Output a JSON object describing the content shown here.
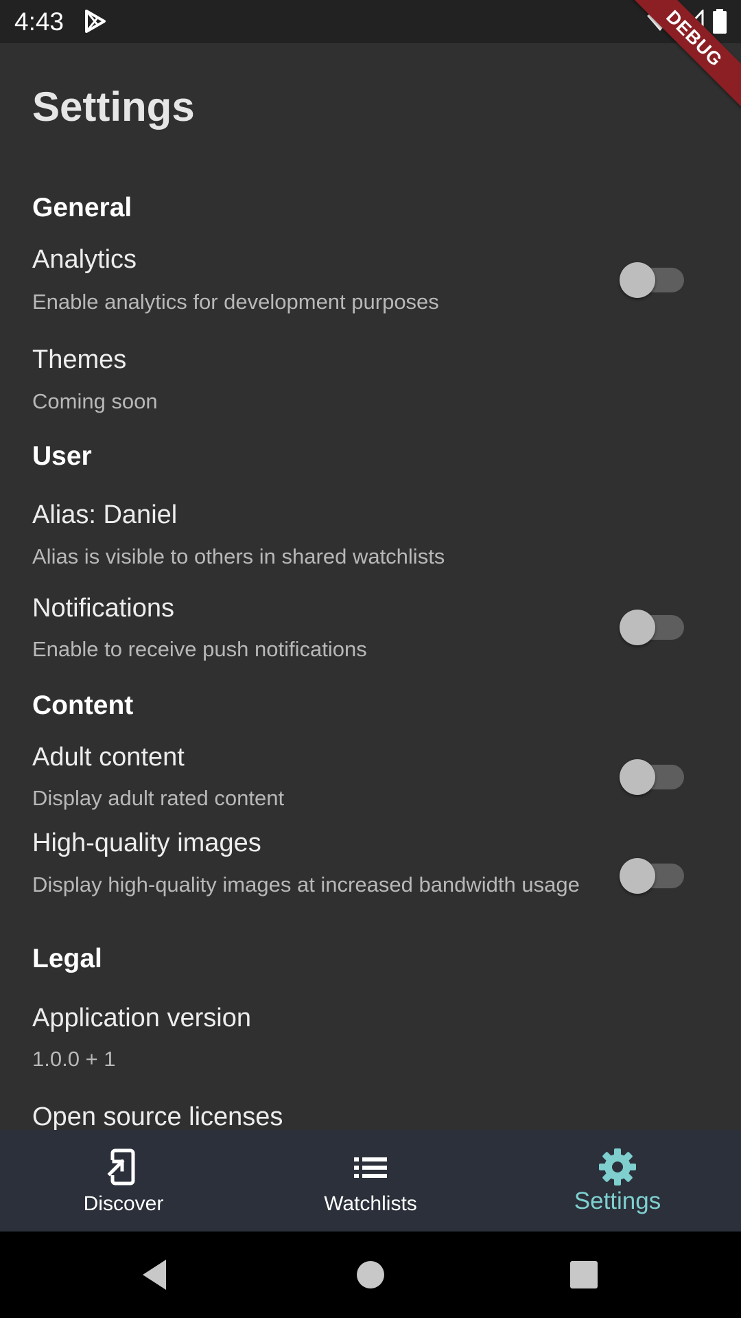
{
  "status_bar": {
    "time": "4:43",
    "icons": [
      "play-store-icon",
      "wifi-icon",
      "signal-icon",
      "battery-icon"
    ]
  },
  "debug_banner": "DEBUG",
  "page": {
    "title": "Settings"
  },
  "sections": {
    "general": {
      "header": "General",
      "analytics": {
        "title": "Analytics",
        "subtitle": "Enable analytics for development purposes",
        "enabled": false
      },
      "themes": {
        "title": "Themes",
        "subtitle": "Coming soon"
      }
    },
    "user": {
      "header": "User",
      "alias": {
        "title": "Alias: Daniel",
        "subtitle": "Alias is visible to others in shared watchlists"
      },
      "notifications": {
        "title": "Notifications",
        "subtitle": "Enable to receive push notifications",
        "enabled": false
      }
    },
    "content": {
      "header": "Content",
      "adult_content": {
        "title": "Adult content",
        "subtitle": "Display adult rated content",
        "enabled": false
      },
      "high_quality_images": {
        "title": "High-quality images",
        "subtitle": "Display high-quality images at increased bandwidth usage",
        "enabled": false
      }
    },
    "legal": {
      "header": "Legal",
      "app_version": {
        "title": "Application version",
        "subtitle": "1.0.0 + 1"
      },
      "licenses": {
        "title": "Open source licenses"
      }
    }
  },
  "bottom_nav": {
    "items": [
      {
        "label": "Discover",
        "icon": "discover-icon"
      },
      {
        "label": "Watchlists",
        "icon": "list-icon"
      },
      {
        "label": "Settings",
        "icon": "gear-icon"
      }
    ],
    "active": "Settings"
  },
  "colors": {
    "background": "#303030",
    "status_bar": "#222222",
    "bottom_nav": "#2b303a",
    "accent": "#7fcfcf",
    "debug": "#8b1f24"
  },
  "system_nav": {
    "buttons": [
      "back-icon",
      "home-icon",
      "recents-icon"
    ]
  }
}
